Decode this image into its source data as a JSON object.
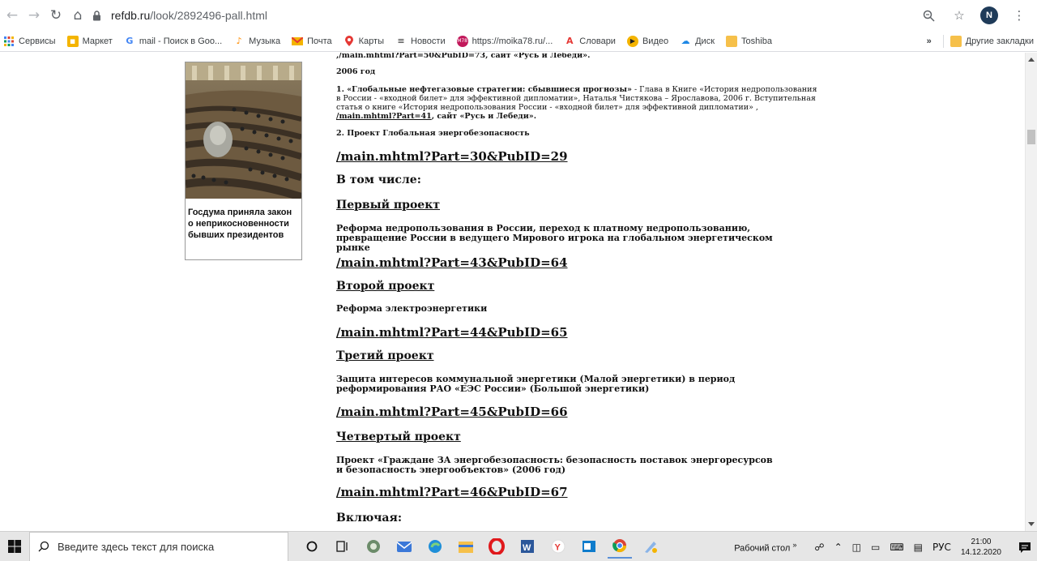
{
  "browser": {
    "url_host": "refdb.ru",
    "url_path": "/look/2892496-pall.html",
    "profile_initial": "N"
  },
  "bookmarks": [
    {
      "label": "Сервисы",
      "icon": "apps-grid-icon",
      "color": "#4285f4"
    },
    {
      "label": "Маркет",
      "icon": "market-icon",
      "color": "#f4b400"
    },
    {
      "label": "mail - Поиск в Goo...",
      "icon": "google-g-icon",
      "color": "#4285f4"
    },
    {
      "label": "Музыка",
      "icon": "music-icon",
      "color": "#ff8c00"
    },
    {
      "label": "Почта",
      "icon": "mail-icon",
      "color": "#f4b400"
    },
    {
      "label": "Карты",
      "icon": "map-pin-icon",
      "color": "#e53935"
    },
    {
      "label": "Новости",
      "icon": "news-icon",
      "color": "#333333"
    },
    {
      "label": "https://moika78.ru/...",
      "icon": "m78-icon",
      "color": "#c2185b"
    },
    {
      "label": "Словари",
      "icon": "dictionary-icon",
      "color": "#e53935"
    },
    {
      "label": "Видео",
      "icon": "video-icon",
      "color": "#f4b400"
    },
    {
      "label": "Диск",
      "icon": "disk-icon",
      "color": "#1e88e5"
    },
    {
      "label": "Toshiba",
      "icon": "folder-icon",
      "color": "#f6c04a"
    }
  ],
  "bookmarks_other": "Другие закладки",
  "bookmarks_more": "»",
  "sidebar": {
    "caption": "Госдума приняла закон о неприкосновенности бывших президентов"
  },
  "article": {
    "top_line": ",/main.mhtml?Part=50&PubID=73, сайт «Русь и Лебеди».",
    "year": "2006 год",
    "item1_bold": "1. «Глобальные нефтегазовые стратегии: сбывшиеся прогнозы»",
    "item1_text": " - Глава в Книге «История недропользования в России - «входной билет» для эффективной дипломатии», Наталья Чистякова – Ярославова, 2006 г. Вступительная статья о книге «История недропользования России - «входной билет» для эффективной дипломатии» , ",
    "item1_link": "/main.mhtml?Part=41",
    "item1_tail": ", сайт «Русь и Лебеди».",
    "item2": "2. Проект Глобальная энергобезопасность",
    "link1": "/main.mhtml?Part=30&PubID=29",
    "including": "В том числе:",
    "proj1_title": "Первый проект",
    "proj1_desc": "Реформа недропользования в России, переход к платному недропользованию, превращение России в ведущего Мирового игрока на глобальном энергетическом рынке",
    "link2": "/main.mhtml?Part=43&PubID=64",
    "proj2_title": "Второй проект",
    "proj2_desc": "Реформа электроэнергетики",
    "link3": "/main.mhtml?Part=44&PubID=65",
    "proj3_title": "Третий проект",
    "proj3_desc": "Защита интересов коммунальной энергетики (Малой энергетики) в период реформирования РАО «ЕЭС России» (Большой энергетики)",
    "link4": "/main.mhtml?Part=45&PubID=66",
    "proj4_title": "Четвертый проект",
    "proj4_desc": "Проект «Граждане ЗА энергобезопасность: безопасность поставок энергоресурсов и безопасность энергообъектов» (2006 год)",
    "link5": "/main.mhtml?Part=46&PubID=67",
    "including2": "Включая:"
  },
  "taskbar": {
    "search_placeholder": "Введите здесь текст для поиска",
    "desktop_label": "Рабочий стол",
    "desktop_more": "»",
    "lang": "РУС",
    "time": "21:00",
    "date": "14.12.2020"
  }
}
